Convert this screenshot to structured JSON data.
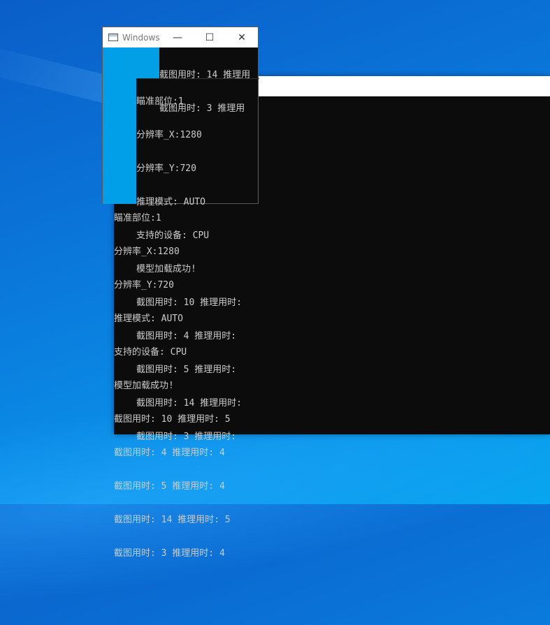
{
  "console": {
    "lines": [
      "瞄准部位:1",
      "分辨率_X:1280",
      "分辨率_Y:720",
      "推理模式: AUTO",
      "支持的设备: CPU",
      "模型加载成功!",
      "截图用时: 10 推理用时: 5",
      "截图用时: 4 推理用时: 4",
      "截图用时: 5 推理用时: 4",
      "截图用时: 14 推理用时: 5",
      "截图用时: 3 推理用时: 4"
    ]
  },
  "small_window": {
    "title": "Windows",
    "minimize_glyph": "—",
    "maximize_glyph": "☐",
    "close_glyph": "✕",
    "top_lines": [
      "截图用时: 14 推理用",
      "截图用时: 3 推理用"
    ],
    "lines": [
      "瞄准部位:1",
      "分辨率_X:1280",
      "分辨率_Y:720",
      "推理模式: AUTO",
      "支持的设备: CPU",
      "模型加载成功!",
      "截图用时: 10 推理用时:",
      "截图用时: 4 推理用时:",
      "截图用时: 5 推理用时:",
      "截图用时: 14 推理用时:",
      "截图用时: 3 推理用时:"
    ]
  }
}
